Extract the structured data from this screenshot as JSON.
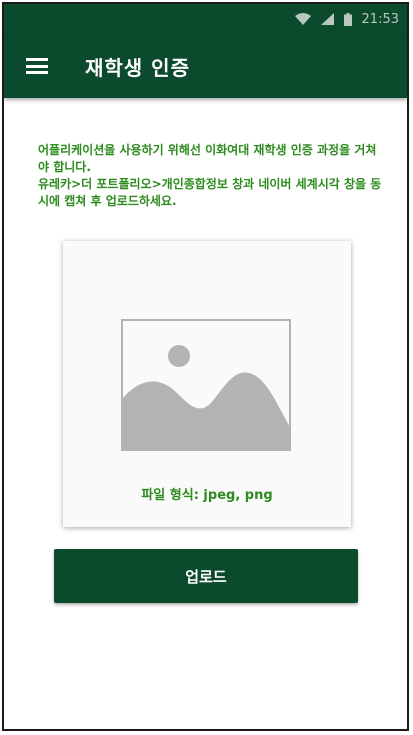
{
  "status_bar": {
    "time": "21:53",
    "icons": [
      "wifi-icon",
      "signal-icon",
      "battery-icon"
    ]
  },
  "app_bar": {
    "menu_icon": "hamburger-menu-icon",
    "title": "재학생 인증"
  },
  "instructions": {
    "line1": "어플리케이션을 사용하기 위해선 이화여대 재학생 인증 과정을 거쳐야 합니다.",
    "line2": "유레카>더 포트폴리오>개인종합정보 창과 네이버 세계시각 창을 동시에 캡쳐 후 업로드하세요."
  },
  "image_picker": {
    "icon": "image-placeholder-icon",
    "format_label": "파일 형식: jpeg, png"
  },
  "upload_button": {
    "label": "업로드"
  },
  "colors": {
    "primary": "#0b4a2c",
    "accent_text": "#2d8c1e",
    "placeholder_gray": "#b3b3b3"
  }
}
